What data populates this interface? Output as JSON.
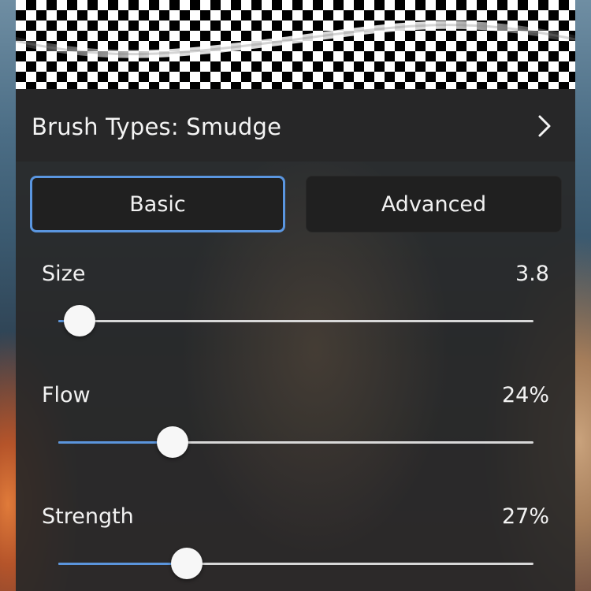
{
  "header": {
    "title": "Brush Types: Smudge",
    "chevron_icon": "chevron-right-icon"
  },
  "tabs": [
    {
      "label": "Basic",
      "selected": true
    },
    {
      "label": "Advanced",
      "selected": false
    }
  ],
  "sliders": [
    {
      "label": "Size",
      "value_text": "3.8",
      "fraction": 0.045
    },
    {
      "label": "Flow",
      "value_text": "24%",
      "fraction": 0.24
    },
    {
      "label": "Strength",
      "value_text": "27%",
      "fraction": 0.27
    }
  ],
  "colors": {
    "accent": "#5a96e0",
    "panel": "#282828",
    "track": "#d8d8d8",
    "text": "#f2f2f2"
  }
}
